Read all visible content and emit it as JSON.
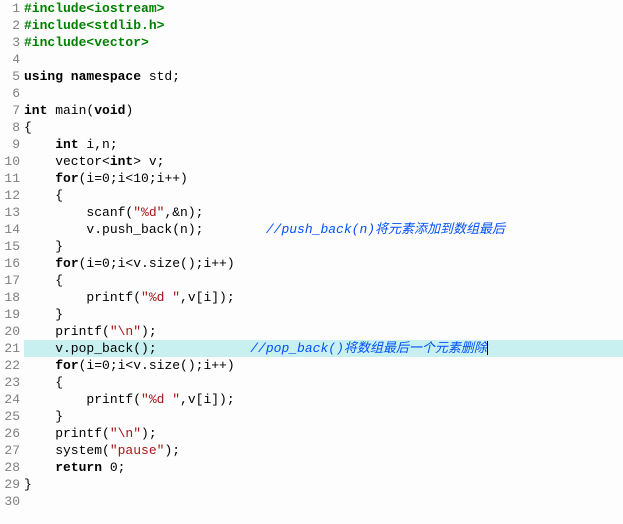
{
  "lines": [
    {
      "num": "1",
      "tokens": [
        {
          "cls": "pp",
          "t": "#include<iostream>"
        }
      ]
    },
    {
      "num": "2",
      "tokens": [
        {
          "cls": "pp",
          "t": "#include<stdlib.h>"
        }
      ]
    },
    {
      "num": "3",
      "tokens": [
        {
          "cls": "pp",
          "t": "#include<vector>"
        }
      ]
    },
    {
      "num": "4",
      "tokens": []
    },
    {
      "num": "5",
      "tokens": [
        {
          "cls": "kw",
          "t": "using namespace"
        },
        {
          "cls": "",
          "t": " std;"
        }
      ]
    },
    {
      "num": "6",
      "tokens": []
    },
    {
      "num": "7",
      "tokens": [
        {
          "cls": "kw",
          "t": "int"
        },
        {
          "cls": "",
          "t": " main("
        },
        {
          "cls": "kw",
          "t": "void"
        },
        {
          "cls": "",
          "t": ")"
        }
      ]
    },
    {
      "num": "8",
      "tokens": [
        {
          "cls": "",
          "t": "{"
        }
      ]
    },
    {
      "num": "9",
      "tokens": [
        {
          "cls": "",
          "t": "    "
        },
        {
          "cls": "kw",
          "t": "int"
        },
        {
          "cls": "",
          "t": " i,n;"
        }
      ]
    },
    {
      "num": "10",
      "tokens": [
        {
          "cls": "",
          "t": "    vector<"
        },
        {
          "cls": "kw",
          "t": "int"
        },
        {
          "cls": "",
          "t": "> v;"
        }
      ]
    },
    {
      "num": "11",
      "tokens": [
        {
          "cls": "",
          "t": "    "
        },
        {
          "cls": "kw",
          "t": "for"
        },
        {
          "cls": "",
          "t": "(i=0;i<10;i++)"
        }
      ]
    },
    {
      "num": "12",
      "tokens": [
        {
          "cls": "",
          "t": "    {"
        }
      ]
    },
    {
      "num": "13",
      "tokens": [
        {
          "cls": "",
          "t": "        scanf("
        },
        {
          "cls": "str",
          "t": "\"%d\""
        },
        {
          "cls": "",
          "t": ",&n);"
        }
      ]
    },
    {
      "num": "14",
      "tokens": [
        {
          "cls": "",
          "t": "        v.push_back(n);        "
        },
        {
          "cls": "cmt",
          "t": "//push_back(n)将元素添加到数组最后"
        }
      ]
    },
    {
      "num": "15",
      "tokens": [
        {
          "cls": "",
          "t": "    }"
        }
      ]
    },
    {
      "num": "16",
      "tokens": [
        {
          "cls": "",
          "t": "    "
        },
        {
          "cls": "kw",
          "t": "for"
        },
        {
          "cls": "",
          "t": "(i=0;i<v.size();i++)"
        }
      ]
    },
    {
      "num": "17",
      "tokens": [
        {
          "cls": "",
          "t": "    {"
        }
      ]
    },
    {
      "num": "18",
      "tokens": [
        {
          "cls": "",
          "t": "        printf("
        },
        {
          "cls": "str",
          "t": "\"%d \""
        },
        {
          "cls": "",
          "t": ",v[i]);"
        }
      ]
    },
    {
      "num": "19",
      "tokens": [
        {
          "cls": "",
          "t": "    }"
        }
      ]
    },
    {
      "num": "20",
      "tokens": [
        {
          "cls": "",
          "t": "    printf("
        },
        {
          "cls": "str",
          "t": "\"\\n\""
        },
        {
          "cls": "",
          "t": ");"
        }
      ]
    },
    {
      "num": "21",
      "hl": true,
      "caret": true,
      "tokens": [
        {
          "cls": "",
          "t": "    v.pop_back();            "
        },
        {
          "cls": "cmt",
          "t": "//pop_back()将数组最后一个元素删除"
        }
      ]
    },
    {
      "num": "22",
      "tokens": [
        {
          "cls": "",
          "t": "    "
        },
        {
          "cls": "kw",
          "t": "for"
        },
        {
          "cls": "",
          "t": "(i=0;i<v.size();i++)"
        }
      ]
    },
    {
      "num": "23",
      "tokens": [
        {
          "cls": "",
          "t": "    {"
        }
      ]
    },
    {
      "num": "24",
      "tokens": [
        {
          "cls": "",
          "t": "        printf("
        },
        {
          "cls": "str",
          "t": "\"%d \""
        },
        {
          "cls": "",
          "t": ",v[i]);"
        }
      ]
    },
    {
      "num": "25",
      "tokens": [
        {
          "cls": "",
          "t": "    }"
        }
      ]
    },
    {
      "num": "26",
      "tokens": [
        {
          "cls": "",
          "t": "    printf("
        },
        {
          "cls": "str",
          "t": "\"\\n\""
        },
        {
          "cls": "",
          "t": ");"
        }
      ]
    },
    {
      "num": "27",
      "tokens": [
        {
          "cls": "",
          "t": "    system("
        },
        {
          "cls": "str",
          "t": "\"pause\""
        },
        {
          "cls": "",
          "t": ");"
        }
      ]
    },
    {
      "num": "28",
      "tokens": [
        {
          "cls": "",
          "t": "    "
        },
        {
          "cls": "kw",
          "t": "return"
        },
        {
          "cls": "",
          "t": " 0;"
        }
      ]
    },
    {
      "num": "29",
      "tokens": [
        {
          "cls": "",
          "t": "}"
        }
      ]
    },
    {
      "num": "30",
      "tokens": []
    }
  ]
}
